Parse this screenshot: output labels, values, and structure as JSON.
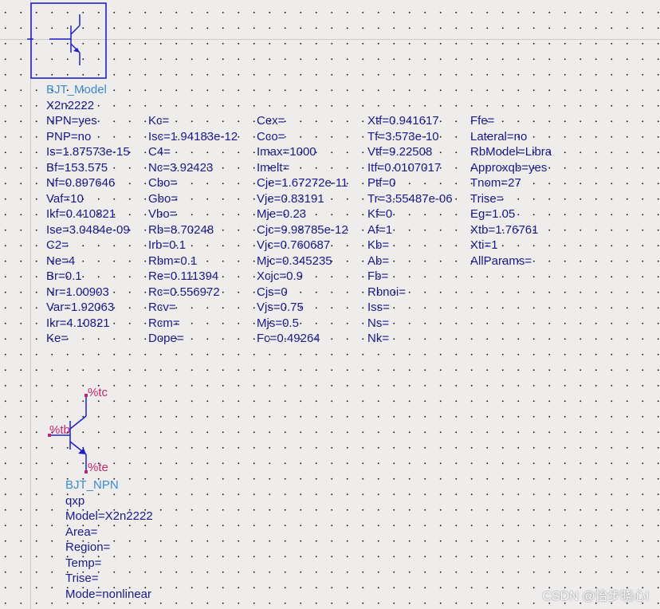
{
  "model": {
    "type_label": "BJT_Model",
    "instance_name": "X2n2222",
    "columns": [
      [
        "NPN=yes",
        "PNP=no",
        "Is=1.87573e-15",
        "Bf=153.575",
        "Nf=0.897646",
        "Vaf=10",
        "Ikf=0.410821",
        "Ise=3.0484e-09",
        "C2=",
        "Ne=4",
        "Br=0.1",
        "Nr=1.00903",
        "Var=1.92063",
        "Ikr=4.10821",
        "Ke="
      ],
      [
        "Kc=",
        "Isc=1.94183e-12",
        "C4=",
        "Nc=3.92423",
        "Cbo=",
        "Gbo=",
        "Vbo=",
        "Rb=8.70248",
        "Irb=0.1",
        "Rbm=0.1",
        "Re=0.111394",
        "Rc=0.556972",
        "Rcv=",
        "Rcm=",
        "Dope="
      ],
      [
        "Cex=",
        "Cco=",
        "Imax=1000",
        "Imelt=",
        "Cje=1.67272e-11",
        "Vje=0.83191",
        "Mje=0.23",
        "Cjc=9.98785e-12",
        "Vjc=0.760687",
        "Mjc=0.345235",
        "Xcjc=0.9",
        "Cjs=0",
        "Vjs=0.75",
        "Mjs=0.5",
        "Fc=0.49264"
      ],
      [
        "Xtf=0.941617",
        "Tf=3.573e-10",
        "Vtf=9.22508",
        "Itf=0.0107017",
        "Ptf=0",
        "Tr=3.55487e-06",
        "Kf=0",
        "Af=1",
        "Kb=",
        "Ab=",
        "Fb=",
        "Rbnoi=",
        "Iss=",
        "Ns=",
        "Nk="
      ],
      [
        "Ffe=",
        "Lateral=no",
        "RbModel=Libra",
        "Approxqb=yes",
        "Tnom=27",
        "Trise=",
        "Eg=1.05",
        "Xtb=1.76761",
        "Xti=1",
        "AllParams="
      ]
    ]
  },
  "instance": {
    "pins": {
      "collector": "%tc",
      "base": "%tb",
      "emitter": "%te"
    },
    "type_label": "BJT_NPN",
    "instance_name": "qxp",
    "params": [
      "Model=X2n2222",
      "Area=",
      "Region=",
      "Temp=",
      "Trise=",
      "Mode=nonlinear"
    ]
  },
  "watermark": "CSDN @怡步晓心l",
  "colors": {
    "wire": "#1f1fcc",
    "pin_label": "#c0286e",
    "component_name": "#3d8ccf",
    "param_text": "#1a1a86",
    "canvas": "#efecec"
  }
}
